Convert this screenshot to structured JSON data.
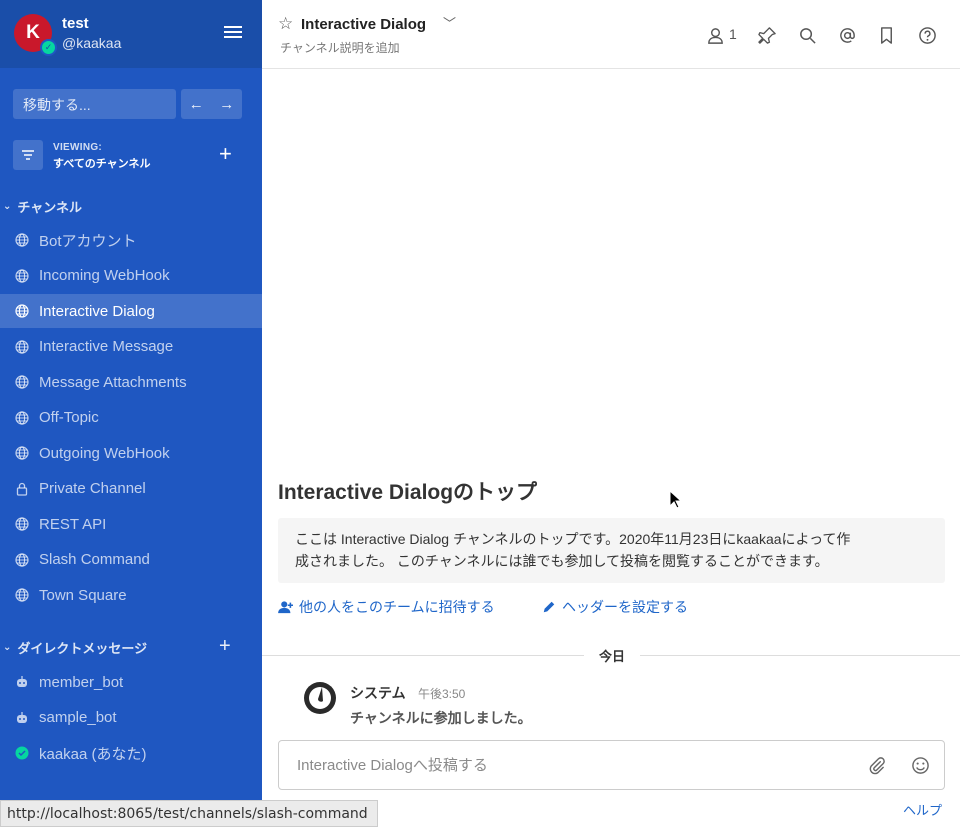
{
  "sidebar": {
    "avatar_letter": "K",
    "team_name": "test",
    "username": "@kaakaa",
    "switcher_placeholder": "移動する...",
    "viewing_label": "VIEWING:",
    "viewing_value": "すべてのチャンネル",
    "channels_header": "チャンネル",
    "channels": [
      {
        "label": "Botアカウント",
        "icon": "globe-icon"
      },
      {
        "label": "Incoming WebHook",
        "icon": "globe-icon"
      },
      {
        "label": "Interactive Dialog",
        "icon": "globe-icon",
        "active": true
      },
      {
        "label": "Interactive Message",
        "icon": "globe-icon"
      },
      {
        "label": "Message Attachments",
        "icon": "globe-icon"
      },
      {
        "label": "Off-Topic",
        "icon": "globe-icon"
      },
      {
        "label": "Outgoing WebHook",
        "icon": "globe-icon"
      },
      {
        "label": "Private Channel",
        "icon": "lock-icon"
      },
      {
        "label": "REST API",
        "icon": "globe-icon"
      },
      {
        "label": "Slash Command",
        "icon": "globe-icon"
      },
      {
        "label": "Town Square",
        "icon": "globe-icon"
      }
    ],
    "dm_header": "ダイレクトメッセージ",
    "dms": [
      {
        "label": "member_bot",
        "icon": "bot-icon"
      },
      {
        "label": "sample_bot",
        "icon": "bot-icon"
      },
      {
        "label": "kaakaa (あなた)",
        "icon": "online-status-icon"
      }
    ],
    "status_url": "http://localhost:8065/test/channels/slash-command"
  },
  "header": {
    "channel_name": "Interactive Dialog",
    "channel_desc": "チャンネル説明を追加",
    "member_count": "1"
  },
  "intro": {
    "title": "Interactive Dialogのトップ",
    "line1": "ここは Interactive Dialog チャンネルのトップです。2020年11月23日にkaakaaによって作",
    "line2": "成されました。 このチャンネルには誰でも参加して投稿を閲覧することができます。",
    "invite_link": "他の人をこのチームに招待する",
    "header_link": "ヘッダーを設定する"
  },
  "date_separator": "今日",
  "post": {
    "author": "システム",
    "time": "午後3:50",
    "message": "チャンネルに参加しました。"
  },
  "composer": {
    "placeholder": "Interactive Dialogへ投稿する"
  },
  "help_label": "ヘルプ",
  "colors": {
    "sidebar": "#1f57c1",
    "sidebar_header": "#1a4ea9",
    "link": "#1f66c9",
    "avatar": "#c9182b",
    "online": "#06d6a0"
  }
}
